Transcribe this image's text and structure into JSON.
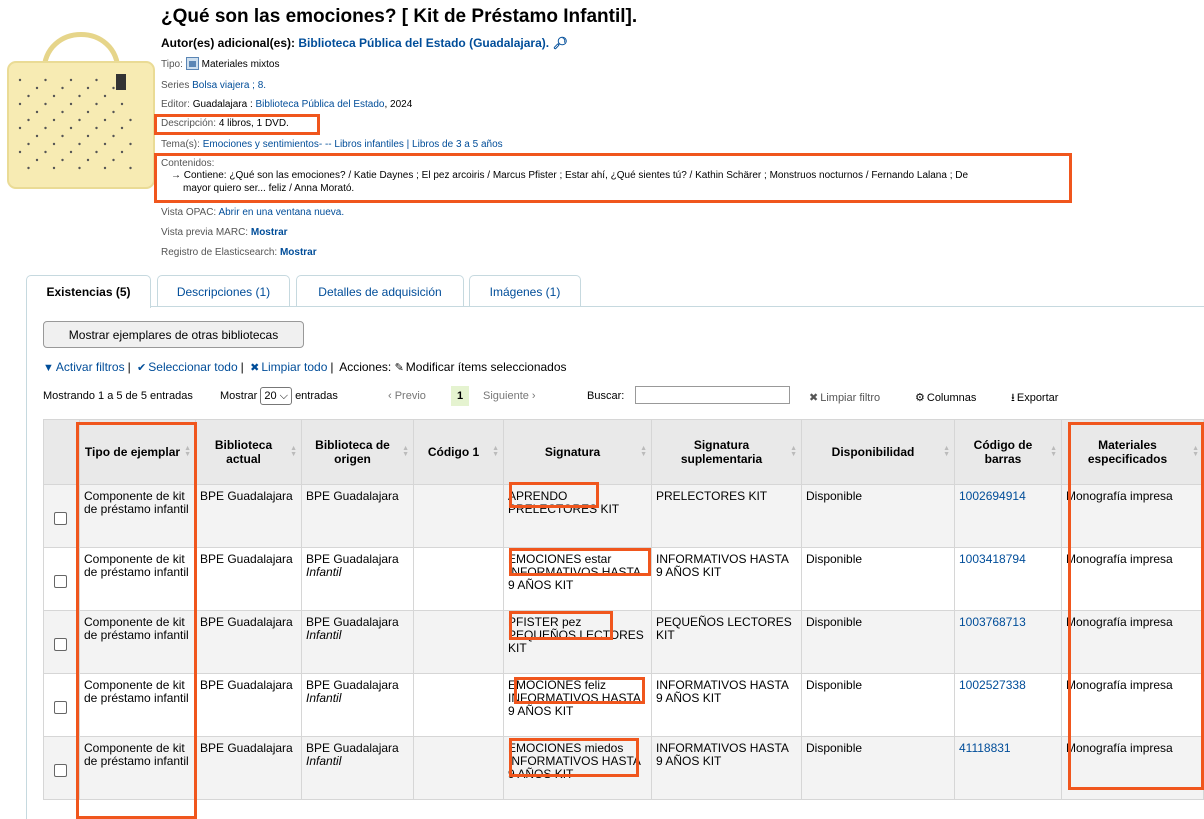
{
  "record": {
    "title": "¿Qué son las emociones? [ Kit de Préstamo Infantil].",
    "authors_label": "Autor(es) adicional(es):",
    "authors_value": "Biblioteca Pública del Estado (Guadalajara).",
    "type_label": "Tipo:",
    "type_value": "Materiales mixtos",
    "series_label": "Series",
    "series_value": "Bolsa viajera ; 8.",
    "publisher_label": "Editor:",
    "publisher_place": "Guadalajara :",
    "publisher_name": "Biblioteca Pública del Estado",
    "publisher_year": ", 2024",
    "description_label": "Descripción:",
    "description_value": "4 libros, 1 DVD.",
    "subjects_label": "Tema(s):",
    "subjects_value": "Emociones y sentimientos- -- Libros infantiles | Libros de 3 a 5 años",
    "contents_label": "Contenidos:",
    "contents_line1": "→ Contiene: ¿Qué son las emociones? / Katie Daynes ; El pez arcoiris / Marcus Pfister ; Estar ahí, ¿Qué sientes tú? / Kathin Schärer ; Monstruos nocturnos / Fernando Lalana ; De",
    "contents_line2": "mayor quiero ser... feliz / Anna Morató.",
    "opac_label": "Vista OPAC:",
    "opac_value": "Abrir en una ventana nueva.",
    "marc_label": "Vista previa MARC:",
    "marc_value": "Mostrar",
    "es_label": "Registro de Elasticsearch:",
    "es_value": "Mostrar"
  },
  "tabs": [
    {
      "label": "Existencias (5)"
    },
    {
      "label": "Descripciones (1)"
    },
    {
      "label": "Detalles de adquisición"
    },
    {
      "label": "Imágenes (1)"
    }
  ],
  "holdings": {
    "other_libraries_button": "Mostrar ejemplares de otras bibliotecas",
    "actions": {
      "filters": "Activar filtros",
      "select_all": "Seleccionar todo",
      "clear_all": "Limpiar todo",
      "actions_label": "Acciones:",
      "modify": "Modificar ítems seleccionados"
    },
    "paging": {
      "showing": "Mostrando 1 a 5 de 5 entradas",
      "show_label": "Mostrar",
      "page_size": "20",
      "entries_label": "entradas",
      "prev": "‹ Previo",
      "current": "1",
      "next": "Siguiente ›",
      "search_label": "Buscar:",
      "search_value": "",
      "clear_filter": "Limpiar filtro",
      "columns": "Columnas",
      "export": "Exportar"
    },
    "columns": [
      "Tipo de ejemplar",
      "Biblioteca actual",
      "Biblioteca de origen",
      "Código 1",
      "Signatura",
      "Signatura suplementaria",
      "Disponibilidad",
      "Código de barras",
      "Materiales especificados"
    ],
    "rows": [
      {
        "type": "Componente de kit de préstamo infantil",
        "current": "BPE Guadalajara",
        "home": "BPE Guadalajara",
        "home_loc": "",
        "code1": "",
        "callnum": "APRENDO PRELECTORES KIT",
        "supp": "PRELECTORES KIT",
        "avail": "Disponible",
        "barcode": "1002694914",
        "materials": "Monografía impresa"
      },
      {
        "type": "Componente de kit de préstamo infantil",
        "current": "BPE Guadalajara",
        "home": "BPE Guadalajara",
        "home_loc": "Infantil",
        "code1": "",
        "callnum": "EMOCIONES estar INFORMATIVOS HASTA 9 AÑOS KIT",
        "supp": "INFORMATIVOS HASTA 9 AÑOS KIT",
        "avail": "Disponible",
        "barcode": "1003418794",
        "materials": "Monografía impresa"
      },
      {
        "type": "Componente de kit de préstamo infantil",
        "current": "BPE Guadalajara",
        "home": "BPE Guadalajara",
        "home_loc": "Infantil",
        "code1": "",
        "callnum": "PFISTER pez PEQUEÑOS LECTORES KIT",
        "supp": "PEQUEÑOS LECTORES KIT",
        "avail": "Disponible",
        "barcode": "1003768713",
        "materials": "Monografía impresa"
      },
      {
        "type": "Componente de kit de préstamo infantil",
        "current": "BPE Guadalajara",
        "home": "BPE Guadalajara",
        "home_loc": "Infantil",
        "code1": "",
        "callnum": "EMOCIONES feliz INFORMATIVOS HASTA 9 AÑOS KIT",
        "supp": "INFORMATIVOS HASTA 9 AÑOS KIT",
        "avail": "Disponible",
        "barcode": "1002527338",
        "materials": "Monografía impresa"
      },
      {
        "type": "Componente de kit de préstamo infantil",
        "current": "BPE Guadalajara",
        "home": "BPE Guadalajara",
        "home_loc": "Infantil",
        "code1": "",
        "callnum": "EMOCIONES miedos INFORMATIVOS HASTA 9 AÑOS KIT",
        "supp": "INFORMATIVOS HASTA 9 AÑOS KIT",
        "avail": "Disponible",
        "barcode": "41118831",
        "materials": "Monografía impresa"
      }
    ]
  },
  "colors": {
    "link": "#004d99",
    "annotation": "#f0561d",
    "current_page": "#e5f3d0"
  }
}
